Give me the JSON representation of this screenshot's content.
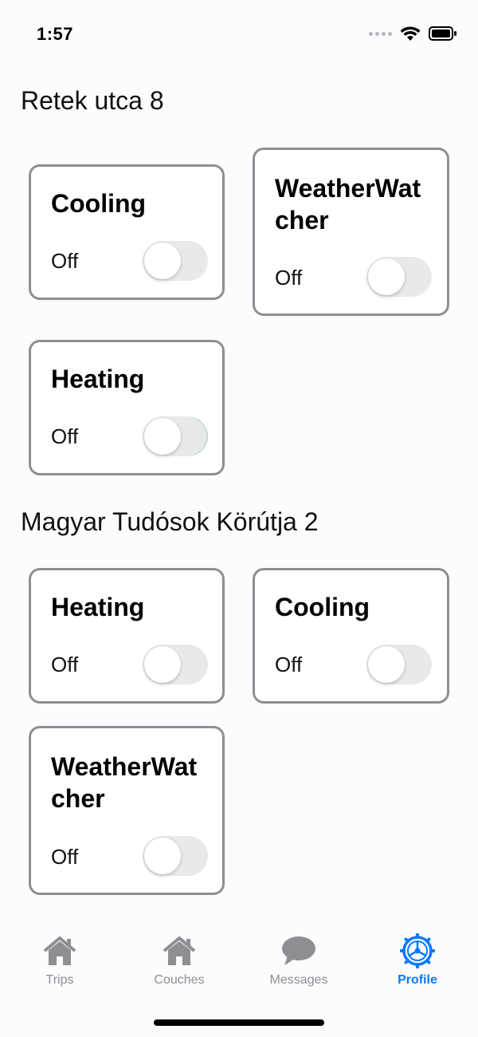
{
  "status_bar": {
    "time": "1:57"
  },
  "sections": [
    {
      "title": "Retek utca 8",
      "devices": [
        {
          "name": "Cooling",
          "state": "Off",
          "enabled": false
        },
        {
          "name": "WeatherWatcher",
          "state": "Off",
          "enabled": false
        },
        {
          "name": "Heating",
          "state": "Off",
          "enabled": false
        }
      ]
    },
    {
      "title": "Magyar Tudósok Körútja 2",
      "devices": [
        {
          "name": "Heating",
          "state": "Off",
          "enabled": false
        },
        {
          "name": "Cooling",
          "state": "Off",
          "enabled": false
        },
        {
          "name": "WeatherWatcher",
          "state": "Off",
          "enabled": false
        }
      ]
    }
  ],
  "tab_bar": {
    "tabs": [
      {
        "label": "Trips",
        "icon": "house-icon",
        "active": false
      },
      {
        "label": "Couches",
        "icon": "house-icon",
        "active": false
      },
      {
        "label": "Messages",
        "icon": "speech-bubble-icon",
        "active": false
      },
      {
        "label": "Profile",
        "icon": "gear-wheel-icon",
        "active": true
      }
    ]
  },
  "colors": {
    "accent": "#0a7aff",
    "inactive": "#8e8e93",
    "card_border": "#8e8e93",
    "toggle_off": "#e9e9eb"
  }
}
